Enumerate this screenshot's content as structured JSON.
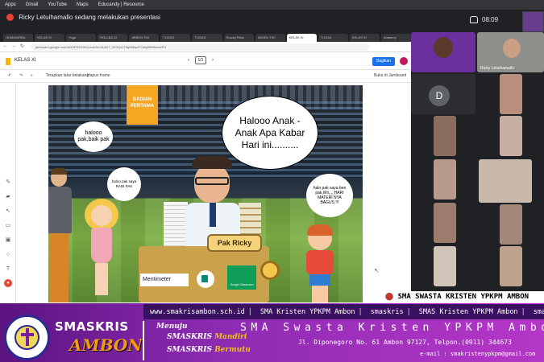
{
  "browser_bookmarks": [
    "Apps",
    "Gmail",
    "YouTube",
    "Maps",
    "Educandy | Resource"
  ],
  "meet": {
    "presenting_text": "Ricky Letuihamallo sedang melakukan presentasi",
    "clock": "08:09"
  },
  "browser": {
    "tabs": [
      "HUMANIORA",
      "KELAS XI",
      "Yoga",
      "ROLLBA 22",
      "ABSEN TIKI",
      "TUGAS",
      "TUGAS",
      "Roway Resc",
      "ABSEN TIKI",
      "KELAS XI",
      "TUGAS",
      "KELAS XI",
      "Anatomy"
    ],
    "active_tab_index": 9,
    "url": "jamboard.google.com/d/1DEROHNCpzoe2eL0L6N7_VK3QxJT5gHMlyaTCetqfAlB5eeel/Fl1"
  },
  "jamboard": {
    "title": "KELAS XI",
    "page_current": "1/1",
    "share_label": "Bagikan",
    "toolbar": {
      "set_background": "Tetapkan latar belakang",
      "clear_frame": "Hapus frame",
      "view_jamboard": "Buka di Jamboard"
    },
    "canvas": {
      "badge": "BAGIAN\nPERTAMA",
      "bubble_student": "halooo pak,baik pak",
      "bubble_girl": "haloo pak saya RANI PAK",
      "bubble_main": "Halooo Anak - Anak  Apa Kabar Hari ini..........",
      "bubble_boy": "halo pak  saya ben pak,Wii,,,, HARI MATERI NYA BAGUS !!!",
      "nameplate": "Pak Ricky",
      "menti_label": "Mentimeter",
      "classroom_label": "Google Classroom"
    }
  },
  "participants": {
    "host_tag": "Ricky Letuihamallo",
    "initial_avatar": "D"
  },
  "overlay": {
    "school_tag": "SMA SWASTA KRISTEN YPKPM AMBON"
  },
  "banner": {
    "website": "www.smakrisambon.sch.id",
    "youtube": "SMA Kristen YPKPM Ambon",
    "instagram": "smaskris",
    "facebook": "SMAS Kristen YPKPM Ambon",
    "twitter": "smaskris",
    "logo_top": "SMASKRIS",
    "logo_bottom": "AMBON",
    "crest_ring": "SMA KRISTEN YPKPM AMBON",
    "motto_lead": "Menuju",
    "motto_1a": "SMASKRIS ",
    "motto_1b": "Mandiri",
    "motto_2a": "SMASKRIS ",
    "motto_2b": "Bermutu",
    "school_name": "SMA Swasta Kristen YPKPM Ambon",
    "address": "Jl. Diponegoro  No. 61 Ambon 97127, Telpon.(0911) 344673",
    "email": "e-mail : smakristenypkpm@gmail.com"
  },
  "colors": {
    "banner_purple": "#7a1fa2",
    "accent_orange": "#f39c12",
    "meet_dark": "#202124",
    "share_blue": "#1a73e8"
  }
}
